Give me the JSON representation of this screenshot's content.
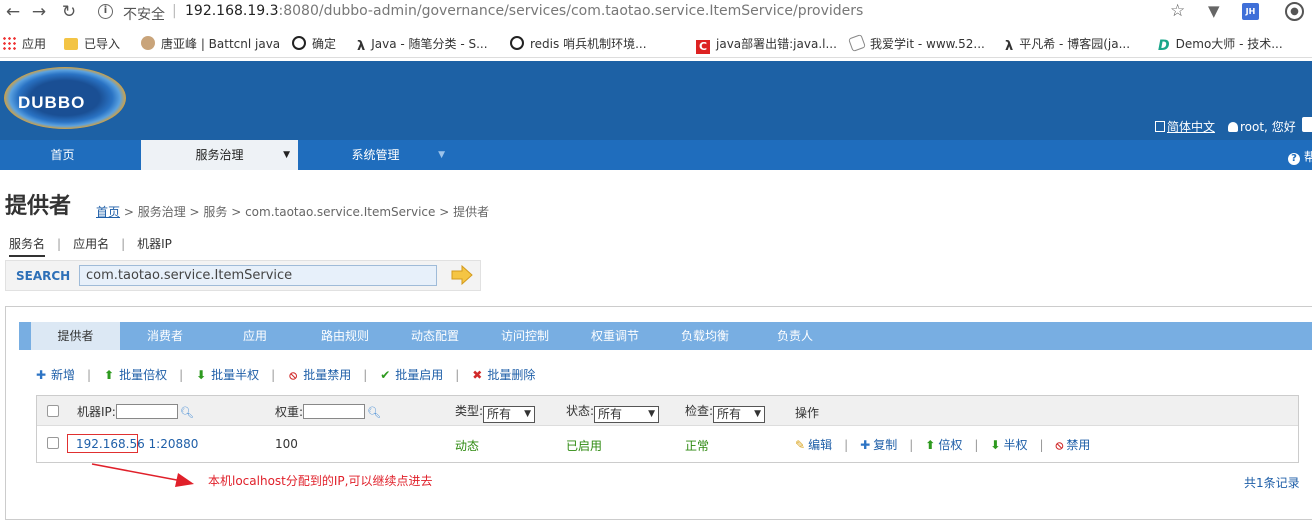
{
  "browser": {
    "security_label": "不安全",
    "url_host": "192.168.19.3",
    "url_rest": ":8080/dubbo-admin/governance/services/com.taotao.service.ItemService/providers",
    "extension_jh": "JH",
    "bookmarks": [
      {
        "label": "应用",
        "icon": "apps-icon"
      },
      {
        "label": "已导入",
        "icon": "folder-icon"
      },
      {
        "label": "唐亚峰 | Battcnl java",
        "icon": "person-icon"
      },
      {
        "label": "确定",
        "icon": "globe-icon"
      },
      {
        "label": "Java - 随笔分类 - S...",
        "icon": "lambda-icon"
      },
      {
        "label": "redis 哨兵机制环境...",
        "icon": "globe-icon"
      },
      {
        "label": "java部署出错:java.l...",
        "icon": "csdn-icon"
      },
      {
        "label": "我爱学it - www.52...",
        "icon": "leaf-icon"
      },
      {
        "label": "平凡希 - 博客园(ja...",
        "icon": "lambda-icon"
      },
      {
        "label": "Demo大师 - 技术...",
        "icon": "demo-icon"
      }
    ]
  },
  "header": {
    "logo_text": "DUBBO",
    "language": "简体中文",
    "user_greeting": "root, 您好"
  },
  "menu": {
    "items": [
      {
        "label": "首页"
      },
      {
        "label": "服务治理"
      },
      {
        "label": "系统管理"
      }
    ],
    "help": "帮"
  },
  "page": {
    "title": "提供者",
    "breadcrumb": {
      "home": "首页",
      "rest": " > 服务治理 > 服务 > com.taotao.service.ItemService > 提供者"
    },
    "search_tabs": [
      "服务名",
      "应用名",
      "机器IP"
    ],
    "search_label": "SEARCH",
    "search_value": "com.taotao.service.ItemService"
  },
  "tabs": [
    "提供者",
    "消费者",
    "应用",
    "路由规则",
    "动态配置",
    "访问控制",
    "权重调节",
    "负载均衡",
    "负责人"
  ],
  "actions": [
    {
      "label": "新增",
      "icon": "plus-icon",
      "glyph": "✚",
      "color": "#2d74c4"
    },
    {
      "label": "批量倍权",
      "icon": "arrow-up-icon",
      "glyph": "⬆",
      "color": "#2e9a1f"
    },
    {
      "label": "批量半权",
      "icon": "arrow-down-icon",
      "glyph": "⬇",
      "color": "#2e9a1f"
    },
    {
      "label": "批量禁用",
      "icon": "ban-icon",
      "glyph": "⦸",
      "color": "#d12a2a"
    },
    {
      "label": "批量启用",
      "icon": "check-icon",
      "glyph": "✔",
      "color": "#2e9a1f"
    },
    {
      "label": "批量删除",
      "icon": "delete-icon",
      "glyph": "✖",
      "color": "#d12a2a"
    }
  ],
  "table": {
    "headers": {
      "ip": "机器IP:",
      "weight": "权重:",
      "type": "类型:",
      "status": "状态:",
      "check": "检查:",
      "ops": "操作"
    },
    "filters": {
      "type": "所有",
      "status": "所有",
      "check": "所有"
    },
    "row": {
      "ip": "192.168.56",
      "port": "1:20880",
      "weight": "100",
      "type": "动态",
      "status": "已启用",
      "check": "正常"
    },
    "row_ops": [
      {
        "label": "编辑",
        "icon": "pencil-icon",
        "glyph": "✎",
        "color": "#d9a21a"
      },
      {
        "label": "复制",
        "icon": "copy-icon",
        "glyph": "✚",
        "color": "#2d74c4"
      },
      {
        "label": "倍权",
        "icon": "arrow-up-icon",
        "glyph": "⬆",
        "color": "#2e9a1f"
      },
      {
        "label": "半权",
        "icon": "arrow-down-icon",
        "glyph": "⬇",
        "color": "#2e9a1f"
      },
      {
        "label": "禁用",
        "icon": "ban-icon",
        "glyph": "⦸",
        "color": "#d12a2a"
      }
    ]
  },
  "annotation": "本机localhost分配到的IP,可以继续点进去",
  "total": "共1条记录"
}
